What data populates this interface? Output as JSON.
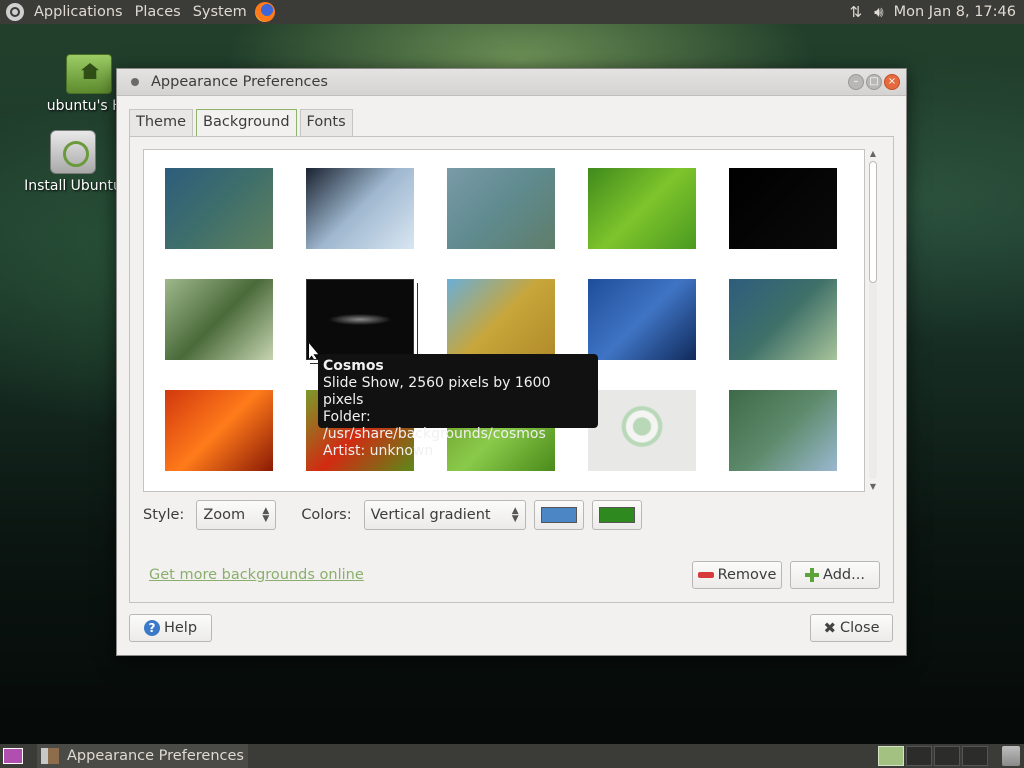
{
  "top_panel": {
    "menus": [
      "Applications",
      "Places",
      "System"
    ],
    "clock": "Mon Jan 8, 17:46"
  },
  "desktop": {
    "icons": [
      {
        "label": "ubuntu's Ho",
        "icon": "home-folder-icon"
      },
      {
        "label": "Install Ubuntu",
        "icon": "installer-icon"
      }
    ]
  },
  "window": {
    "title": "Appearance Preferences",
    "tabs": [
      "Theme",
      "Background",
      "Fonts"
    ],
    "active_tab": "Background",
    "thumbnails": [
      {
        "colors": [
          "#2d5d7d",
          "#3f6f6a",
          "#5f8060"
        ]
      },
      {
        "colors": [
          "#1a2330",
          "#9fb8d0",
          "#d8e6f2"
        ]
      },
      {
        "colors": [
          "#7a9aa8",
          "#5f8a8e",
          "#5f7e6b"
        ]
      },
      {
        "colors": [
          "#3f8a1c",
          "#7ec42c",
          "#4a9a20"
        ]
      },
      {
        "colors": [
          "#000000",
          "#050505",
          "#0a0a0a"
        ]
      },
      {
        "colors": [
          "#9eb88c",
          "#4a6a3a",
          "#c6d4b0"
        ]
      },
      {
        "colors": [
          "#0a0a0a",
          "#8a8a8a",
          "#1a1a1a"
        ]
      },
      {
        "colors": [
          "#6aaed6",
          "#c8a63a",
          "#b08a2a"
        ]
      },
      {
        "colors": [
          "#1e4e9a",
          "#3f74c4",
          "#102a5a"
        ]
      },
      {
        "colors": [
          "#2d5d7d",
          "#3f7068",
          "#a8c49a"
        ]
      },
      {
        "colors": [
          "#d2380e",
          "#ff7b1a",
          "#8a1a06"
        ]
      },
      {
        "colors": [
          "#7a9a2a",
          "#d22a12",
          "#5a8a1a"
        ]
      },
      {
        "colors": [
          "#6a9a2a",
          "#8aca4a",
          "#4a8a1a"
        ]
      },
      {
        "colors": [
          "#f4f4f2",
          "#e8e8e6",
          "#b8d8b8"
        ]
      },
      {
        "colors": [
          "#3f6a4a",
          "#5d8a6a",
          "#9ab8d0"
        ]
      }
    ],
    "tooltip": {
      "title": "Cosmos",
      "line1": "Slide Show, 2560 pixels by 1600 pixels",
      "line2": "Folder: /usr/share/backgrounds/cosmos",
      "line3": "Artist: unknown"
    },
    "style_label": "Style:",
    "style_value": "Zoom",
    "colors_label": "Colors:",
    "colors_value": "Vertical gradient",
    "primary_color": "#4d86c4",
    "secondary_color": "#2e8a1e",
    "link_text": "Get more backgrounds online",
    "remove_label": "Remove",
    "add_label": "Add...",
    "help_label": "Help",
    "close_label": "Close"
  },
  "bottom_panel": {
    "task_label": "Appearance Preferences"
  }
}
